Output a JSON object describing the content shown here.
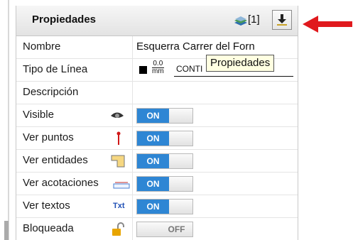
{
  "panel": {
    "title": "Propiedades",
    "layer_count": "[1]",
    "download_icon": "download-arrow-icon",
    "layers_icon": "layers-icon"
  },
  "rows": [
    {
      "label": "Nombre",
      "value": "Esquerra Carrer del Forn"
    },
    {
      "label": "Tipo de Línea",
      "line_weight_top": "0.0",
      "line_weight_unit": "mm",
      "line_type": "CONTI"
    },
    {
      "label": "Descripción",
      "value": ""
    },
    {
      "label": "Visible",
      "icon": "eye-icon",
      "toggle": "ON"
    },
    {
      "label": "Ver puntos",
      "icon": "point-marker-icon",
      "toggle": "ON"
    },
    {
      "label": "Ver entidades",
      "icon": "entity-shape-icon",
      "toggle": "ON"
    },
    {
      "label": "Ver acotaciones",
      "icon": "dimension-icon",
      "toggle": "ON"
    },
    {
      "label": "Ver textos",
      "icon": "text-icon",
      "icon_text": "Txt",
      "toggle": "ON"
    },
    {
      "label": "Bloqueada",
      "icon": "padlock-open-icon",
      "toggle": "OFF"
    }
  ],
  "tooltip": {
    "text": "Propiedades"
  },
  "colors": {
    "toggle_on": "#2e86d4",
    "arrow": "#e0191d"
  }
}
